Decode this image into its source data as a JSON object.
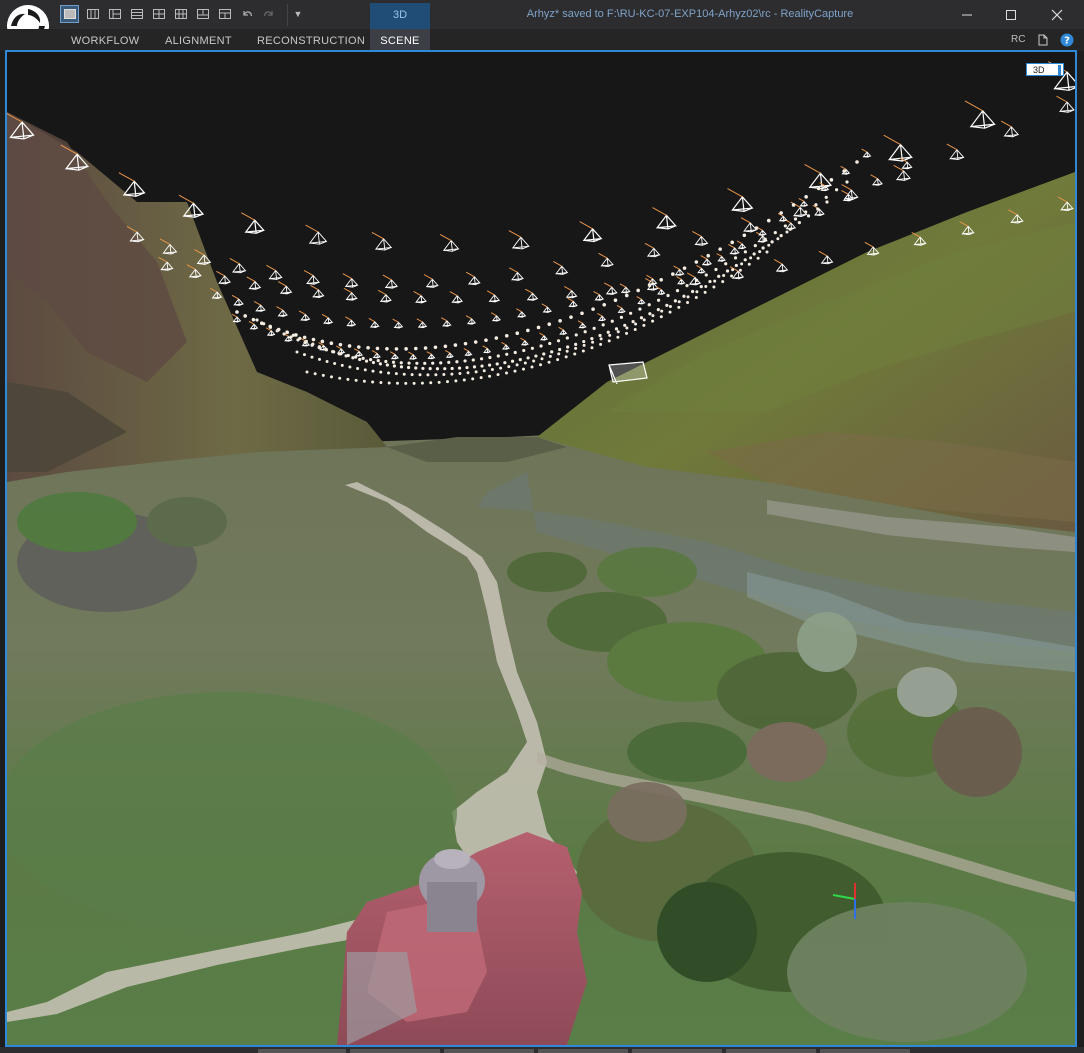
{
  "window": {
    "title": "Arhyz* saved to F:\\RU-KC-07-EXP104-Arhyz02\\rc - RealityCapture",
    "context_tab": "3D"
  },
  "menu": {
    "tabs": [
      {
        "label": "WORKFLOW"
      },
      {
        "label": "ALIGNMENT"
      },
      {
        "label": "RECONSTRUCTION"
      },
      {
        "label": "SCENE"
      }
    ],
    "right": {
      "rc_label": "RC"
    }
  },
  "viewport": {
    "view_label": "3D"
  },
  "colors": {
    "accent": "#2f89d8",
    "title_text": "#7fa3c8",
    "sky": "#171717",
    "camera_frustum": "#ffffff",
    "camera_direction": "#e8954a"
  }
}
